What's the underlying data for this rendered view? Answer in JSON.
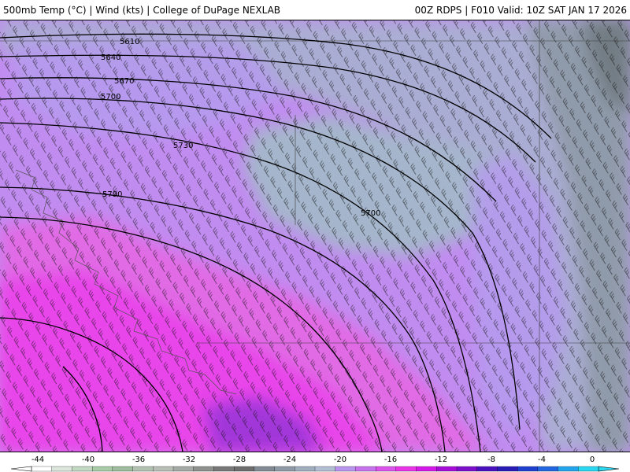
{
  "header": {
    "title_left": "500mb Temp (°C) | Wind (kts) | College of DuPage NEXLAB",
    "title_right": "00Z RDPS | F010 Valid: 10Z SAT JAN 17 2026"
  },
  "colors": {
    "deep_magenta": "#e844ea",
    "magenta": "#e16be5",
    "violet": "#c18cf0",
    "lilac": "#b59bee",
    "grey_blue": "#a5b6cc",
    "slate": "#8d99a6",
    "dark_grey": "#707980",
    "purple": "#9a36d8"
  },
  "contours": {
    "labels": [
      "5610",
      "5640",
      "5670",
      "5700",
      "5730",
      "5790",
      "5700"
    ]
  },
  "colorbar": {
    "ticks": [
      "-44",
      "-40",
      "-36",
      "-32",
      "-28",
      "-24",
      "-20",
      "-16",
      "-12",
      "-8",
      "-4",
      "0"
    ],
    "segments": [
      "#ffffff",
      "#dde6dd",
      "#c2d8c3",
      "#a8cba8",
      "#9ebd9d",
      "#b2c2b2",
      "#b9bfb7",
      "#a6aaa6",
      "#8e918e",
      "#777877",
      "#6f6e6f",
      "#828a93",
      "#8f9aa7",
      "#a0aebf",
      "#b2bfd3",
      "#b894ee",
      "#c972ee",
      "#dc52ec",
      "#e934ea",
      "#d617ea",
      "#a70dd9",
      "#7b0fcc",
      "#4a10c0",
      "#2a1ab8",
      "#1e3fd0",
      "#2166e0",
      "#24a4ec",
      "#2ad8f2"
    ]
  }
}
